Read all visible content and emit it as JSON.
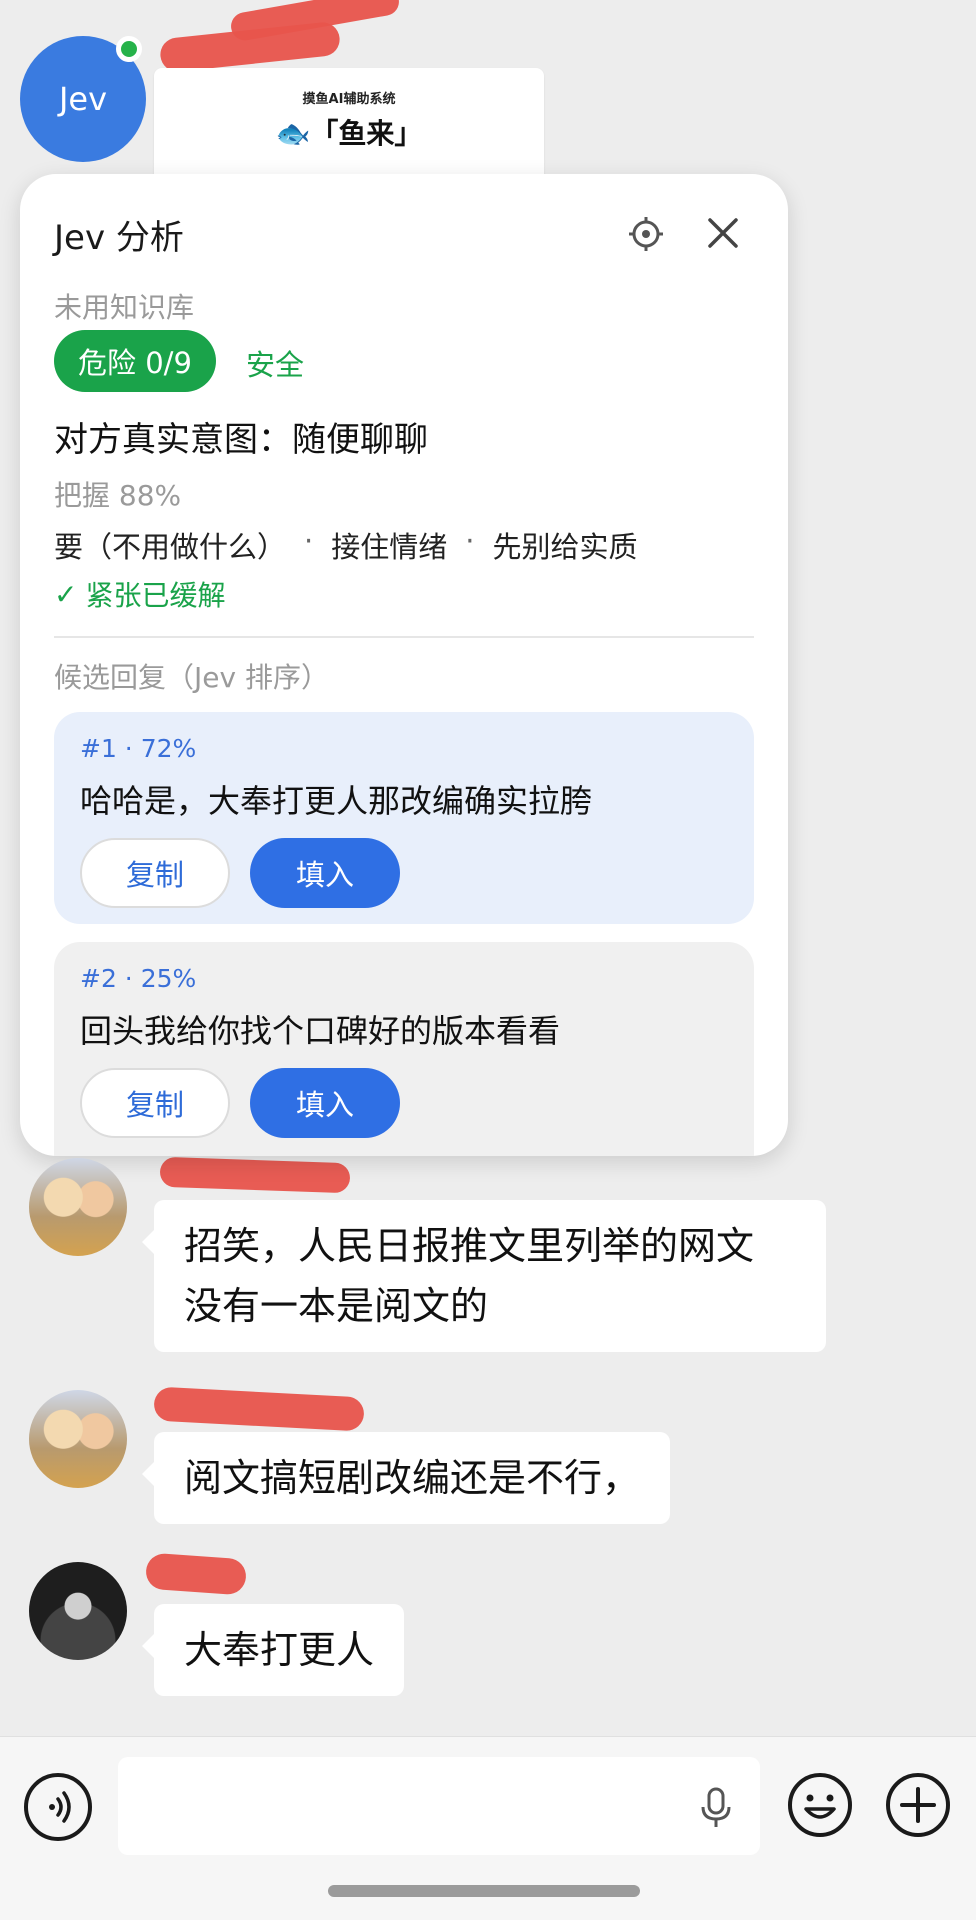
{
  "chat": {
    "shared_card": {
      "subtitle": "摸鱼AI辅助系统",
      "title": "🐟「鱼来」"
    },
    "avatar_jev_label": "Jev",
    "messages": [
      {
        "text": "招笑，人民日报推文里列举的网文\n没有一本是阅文的"
      },
      {
        "text": "阅文搞短剧改编还是不行，"
      },
      {
        "text": "大奉打更人"
      }
    ]
  },
  "panel": {
    "title": "Jev 分析",
    "settings_icon": "settings-icon",
    "close_icon": "close-icon",
    "kb_status": "未用知识库",
    "risk_badge": "危险 0/9",
    "risk_safe": "安全",
    "intent": "对方真实意图：随便聊聊",
    "confidence": "把握 88%",
    "strategy": [
      "要（不用做什么）",
      "接住情绪",
      "先别给实质"
    ],
    "strategy_sep": "·",
    "tension_check": "✓",
    "tension": "紧张已缓解",
    "candidates_title": "候选回复（Jev 排序）",
    "candidates": [
      {
        "meta": "#1 · 72%",
        "text": "哈哈是，大奉打更人那改编确实拉胯",
        "copy": "复制",
        "fill": "填入"
      },
      {
        "meta": "#2 · 25%",
        "text": "回头我给你找个口碑好的版本看看",
        "copy": "复制",
        "fill": "填入"
      }
    ]
  },
  "colors": {
    "accent_blue": "#2f6fe4",
    "safe_green": "#1aa34a",
    "redaction_red": "#e8544c"
  }
}
